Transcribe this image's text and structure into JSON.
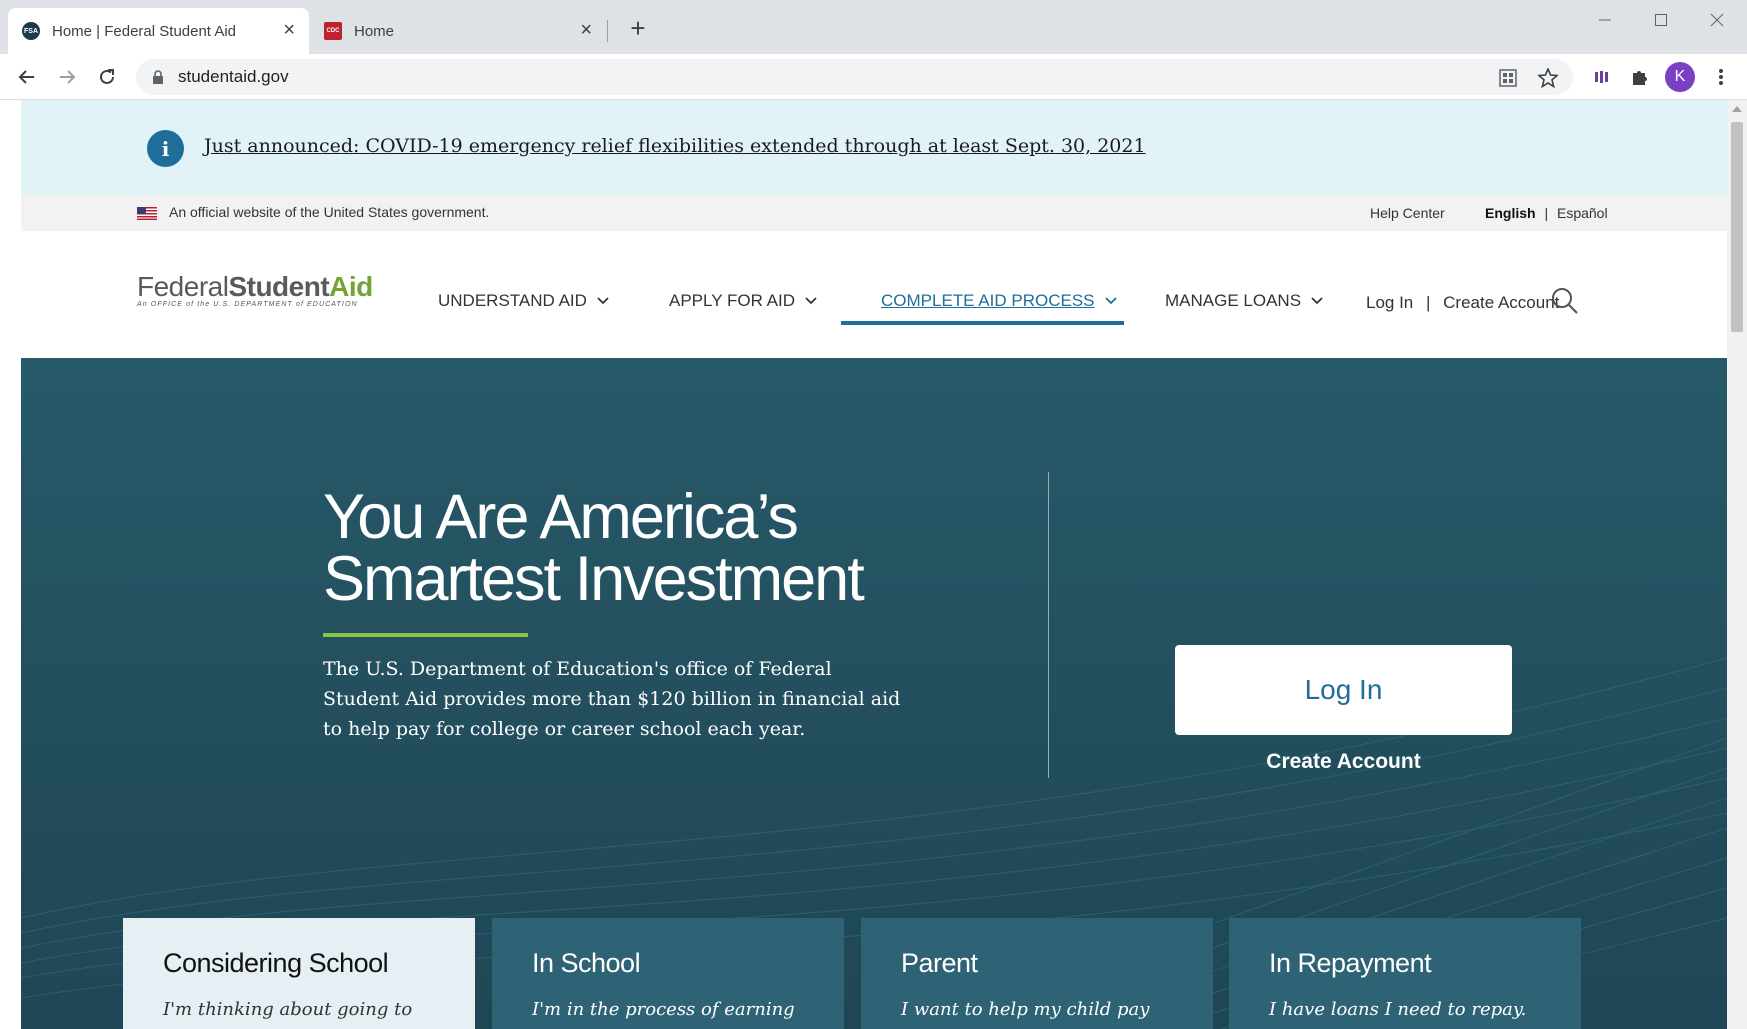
{
  "browser": {
    "tabs": [
      {
        "label": "Home | Federal Student Aid",
        "favicon": "FSA",
        "active": true
      },
      {
        "label": "Home",
        "favicon": "CDC",
        "active": false
      }
    ],
    "url": "studentaid.gov",
    "profile_initial": "K"
  },
  "alert": {
    "text": "Just announced: COVID-19 emergency relief flexibilities extended through at least Sept. 30, 2021"
  },
  "govbar": {
    "official_text": "An official website of the United States government.",
    "help_center": "Help Center",
    "lang_english": "English",
    "lang_separator": "|",
    "lang_espanol": "Español"
  },
  "header": {
    "logo_word1": "Federal",
    "logo_word2": "Student",
    "logo_word3": "Aid",
    "logo_tagline": "An OFFICE of the U.S. DEPARTMENT of EDUCATION",
    "nav": [
      {
        "label": "UNDERSTAND AID"
      },
      {
        "label": "APPLY FOR AID"
      },
      {
        "label": "COMPLETE AID PROCESS"
      },
      {
        "label": "MANAGE LOANS"
      }
    ],
    "login": "Log In",
    "separator": "|",
    "create_account": "Create Account"
  },
  "hero": {
    "title_line1": "You Are America’s",
    "title_line2": "Smartest Investment",
    "description": "The U.S. Department of Education's office of Federal Student Aid provides more than $120 billion in financial aid to help pay for college or career school each year.",
    "login_button": "Log In",
    "create_account": "Create Account"
  },
  "cards": [
    {
      "title": "Considering School",
      "desc": "I'm thinking about going to"
    },
    {
      "title": "In School",
      "desc": "I'm in the process of earning a"
    },
    {
      "title": "Parent",
      "desc": "I want to help my child pay for"
    },
    {
      "title": "In Repayment",
      "desc": "I have loans I need to repay."
    }
  ],
  "colors": {
    "fsa_blue": "#1e6e99",
    "fsa_green": "#73a334",
    "hero_bg": "#234f5e",
    "alert_bg": "#e2f3f8"
  }
}
